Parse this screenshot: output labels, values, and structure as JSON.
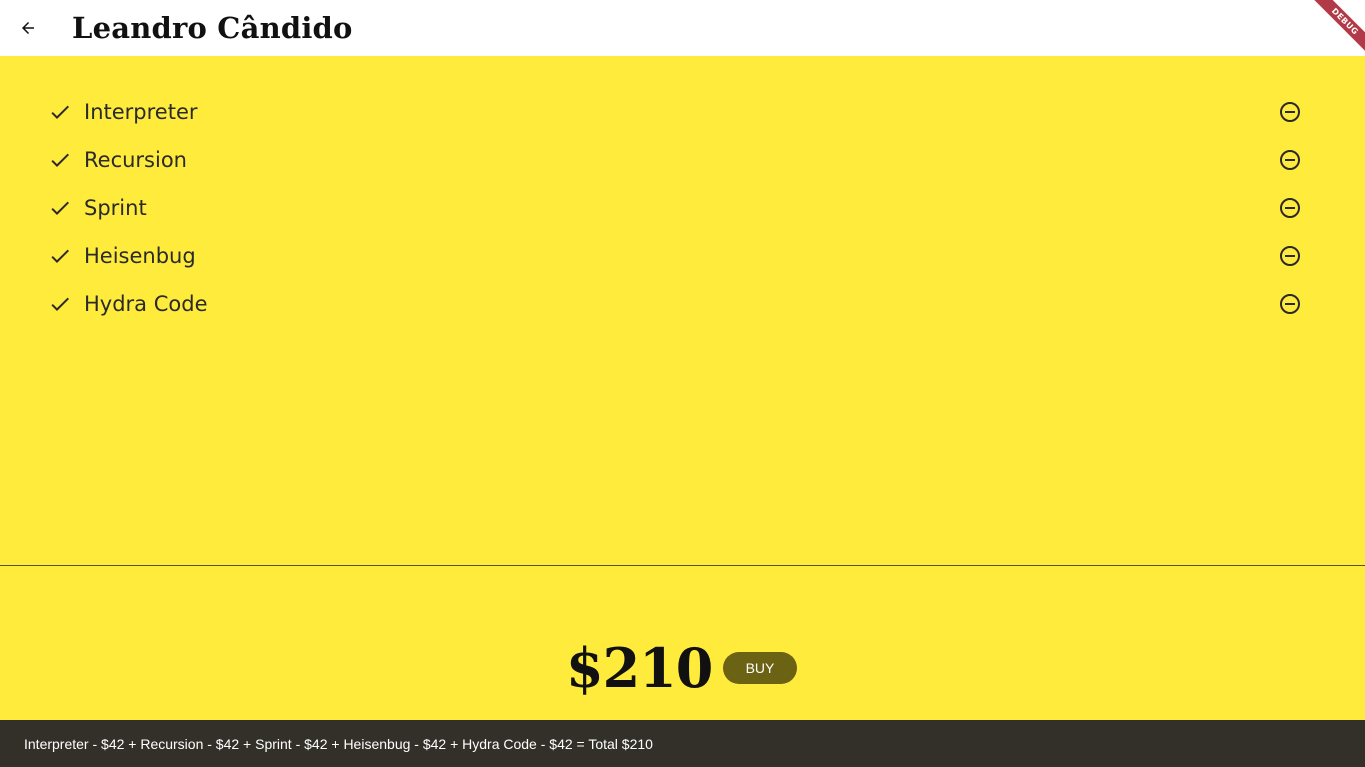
{
  "app_bar": {
    "back_icon": "arrow-back-icon",
    "title": "Leandro Cândido",
    "background": "#ffffff"
  },
  "debug_banner": {
    "label": "DEBUG",
    "color": "#b23a48"
  },
  "cart": {
    "background": "#ffeb3b",
    "items": [
      {
        "label": "Interpreter",
        "status_icon": "check-icon",
        "action_icon": "remove-circle-outline-icon"
      },
      {
        "label": "Recursion",
        "status_icon": "check-icon",
        "action_icon": "remove-circle-outline-icon"
      },
      {
        "label": "Sprint",
        "status_icon": "check-icon",
        "action_icon": "remove-circle-outline-icon"
      },
      {
        "label": "Heisenbug",
        "status_icon": "check-icon",
        "action_icon": "remove-circle-outline-icon"
      },
      {
        "label": "Hydra Code",
        "status_icon": "check-icon",
        "action_icon": "remove-circle-outline-icon"
      }
    ]
  },
  "checkout": {
    "total": "$210",
    "buy_label": "BUY",
    "buy_color": "#6b6214"
  },
  "snackbar": {
    "message": "Interpreter - $42 + Recursion - $42 + Sprint - $42 + Heisenbug - $42 + Hydra Code - $42 = Total $210",
    "background": "#33302a"
  }
}
